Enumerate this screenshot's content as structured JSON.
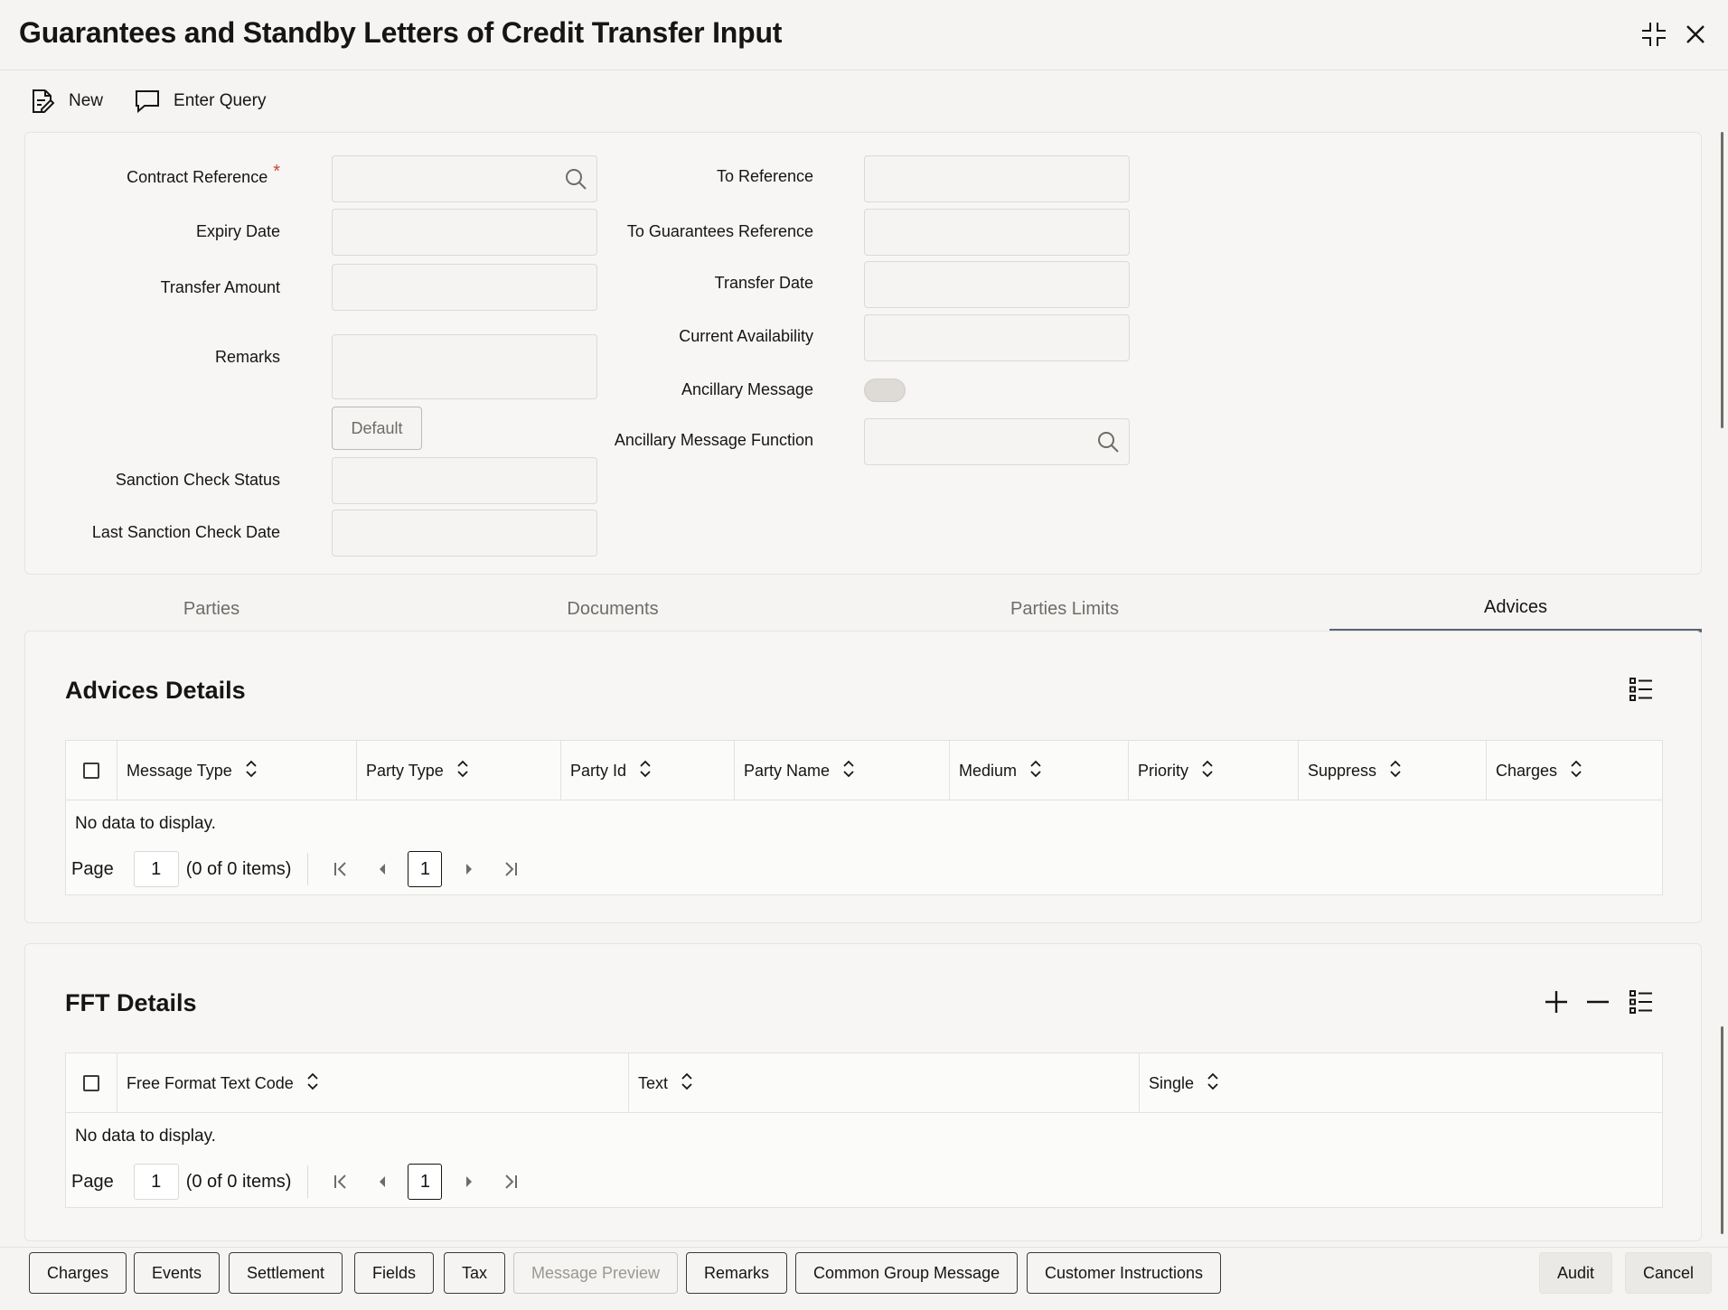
{
  "window": {
    "title": "Guarantees and Standby Letters of Credit Transfer Input"
  },
  "toolbar": {
    "new_label": "New",
    "enter_query_label": "Enter Query"
  },
  "form": {
    "contract_reference": {
      "label": "Contract Reference",
      "required_mark": "*",
      "value": ""
    },
    "expiry_date": {
      "label": "Expiry Date",
      "value": ""
    },
    "transfer_amount": {
      "label": "Transfer Amount",
      "value": ""
    },
    "remarks": {
      "label": "Remarks",
      "value": ""
    },
    "default_button": "Default",
    "sanction_check_status": {
      "label": "Sanction Check Status",
      "value": ""
    },
    "last_sanction_check_date": {
      "label": "Last Sanction Check Date",
      "value": ""
    },
    "to_reference": {
      "label": "To Reference",
      "value": ""
    },
    "to_guarantees_reference": {
      "label": "To Guarantees Reference",
      "value": ""
    },
    "transfer_date": {
      "label": "Transfer Date",
      "value": ""
    },
    "current_availability": {
      "label": "Current Availability",
      "value": ""
    },
    "ancillary_message": {
      "label": "Ancillary Message",
      "checked": false
    },
    "ancillary_message_function": {
      "label": "Ancillary Message Function",
      "value": ""
    }
  },
  "tabs": [
    {
      "label": "Parties",
      "active": false
    },
    {
      "label": "Documents",
      "active": false
    },
    {
      "label": "Parties Limits",
      "active": false
    },
    {
      "label": "Advices",
      "active": true
    }
  ],
  "advices": {
    "title": "Advices Details",
    "columns": [
      "Message Type",
      "Party Type",
      "Party Id",
      "Party Name",
      "Medium",
      "Priority",
      "Suppress",
      "Charges"
    ],
    "empty_text": "No data to display.",
    "pager": {
      "label": "Page",
      "page": "1",
      "summary": "(0 of 0 items)",
      "current": "1"
    }
  },
  "fft": {
    "title": "FFT Details",
    "columns": [
      "Free Format Text Code",
      "Text",
      "Single"
    ],
    "empty_text": "No data to display.",
    "pager": {
      "label": "Page",
      "page": "1",
      "summary": "(0 of 0 items)",
      "current": "1"
    }
  },
  "footer": {
    "buttons": [
      "Charges",
      "Events",
      "Settlement",
      "Fields",
      "Tax",
      "Message Preview",
      "Remarks",
      "Common Group Message",
      "Customer Instructions"
    ],
    "audit": "Audit",
    "cancel": "Cancel"
  },
  "icons": {
    "restore": "collapse-arrows-icon",
    "close": "close-icon",
    "new": "new-document-icon",
    "enter_query": "comment-icon",
    "search": "search-icon",
    "list": "column-list-icon",
    "add": "plus-icon",
    "remove": "minus-icon",
    "sort": "sort-icon"
  }
}
